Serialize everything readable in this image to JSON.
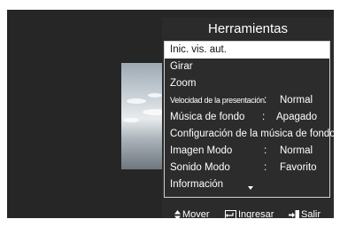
{
  "menu": {
    "title": "Herramientas",
    "items": [
      {
        "label": "Inic. vis. aut.",
        "value": "",
        "colon": "",
        "selected": true
      },
      {
        "label": "Girar",
        "value": "",
        "colon": ""
      },
      {
        "label": "Zoom",
        "value": "",
        "colon": ""
      },
      {
        "label": "Velocidad de la presentación",
        "value": "Normal",
        "colon": ":"
      },
      {
        "label": "Música de fondo",
        "value": "Apagado",
        "colon": ":"
      },
      {
        "label": "Configuración de la música de fondo",
        "value": "",
        "colon": ""
      },
      {
        "label": "Imagen Modo",
        "value": "Normal",
        "colon": ":"
      },
      {
        "label": "Sonido Modo",
        "value": "Favorito",
        "colon": ":"
      },
      {
        "label": "Información",
        "value": "",
        "colon": ""
      }
    ]
  },
  "footer": {
    "move_label": "Mover",
    "enter_label": "Ingresar",
    "exit_label": "Salir"
  },
  "icons": {
    "move": "up-down-arrows-icon",
    "enter": "enter-icon",
    "exit": "exit-icon",
    "scroll": "scroll-down-icon"
  }
}
